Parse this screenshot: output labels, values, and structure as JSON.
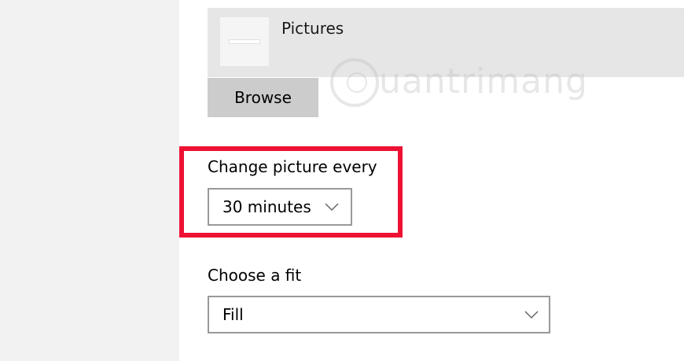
{
  "album": {
    "label": "Pictures"
  },
  "browse": {
    "label": "Browse"
  },
  "watermark": {
    "text": "uantrimang"
  },
  "interval": {
    "label": "Change picture every",
    "value": "30 minutes"
  },
  "fit": {
    "label": "Choose a fit",
    "value": "Fill"
  },
  "colors": {
    "highlight": "#ee1133",
    "sidebar": "#f2f2f2",
    "album_row": "#e6e6e6",
    "button": "#cccccc",
    "border": "#999999"
  },
  "icons": [
    "picture-thumbnail-icon",
    "chevron-down-icon"
  ]
}
